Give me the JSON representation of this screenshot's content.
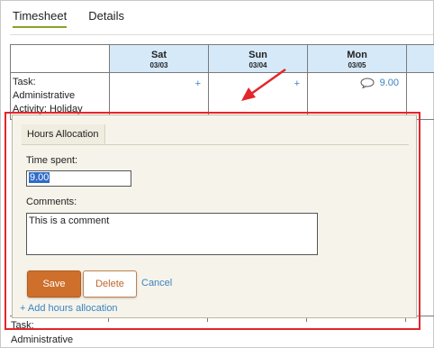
{
  "tabs": [
    {
      "label": "Timesheet",
      "active": true
    },
    {
      "label": "Details",
      "active": false
    }
  ],
  "days": [
    {
      "day": "Sat",
      "date": "03/03"
    },
    {
      "day": "Sun",
      "date": "03/04"
    },
    {
      "day": "Mon",
      "date": "03/05"
    }
  ],
  "task_row_1": {
    "lines": [
      "Task:",
      "Administrative",
      "Activity: Holiday"
    ],
    "cells": [
      {
        "type": "add",
        "label": "+"
      },
      {
        "type": "add",
        "label": "+"
      },
      {
        "type": "hours",
        "label": "9.00",
        "icon": "comment-icon"
      }
    ]
  },
  "task_row_2": {
    "lines": [
      "Task:",
      "Administrative"
    ]
  },
  "popup": {
    "tab_label": "Hours Allocation",
    "time_label": "Time spent:",
    "time_value": "9.00",
    "comments_label": "Comments:",
    "comments_value": "This is a comment",
    "save_label": "Save",
    "delete_label": "Delete",
    "cancel_label": "Cancel",
    "add_label": "+ Add hours allocation"
  },
  "colors": {
    "accent_tab": "#8aa526",
    "header_bg": "#d6e9f8",
    "link": "#3b83c4",
    "save_bg": "#cf6f2c",
    "annotation": "#e3262b"
  }
}
